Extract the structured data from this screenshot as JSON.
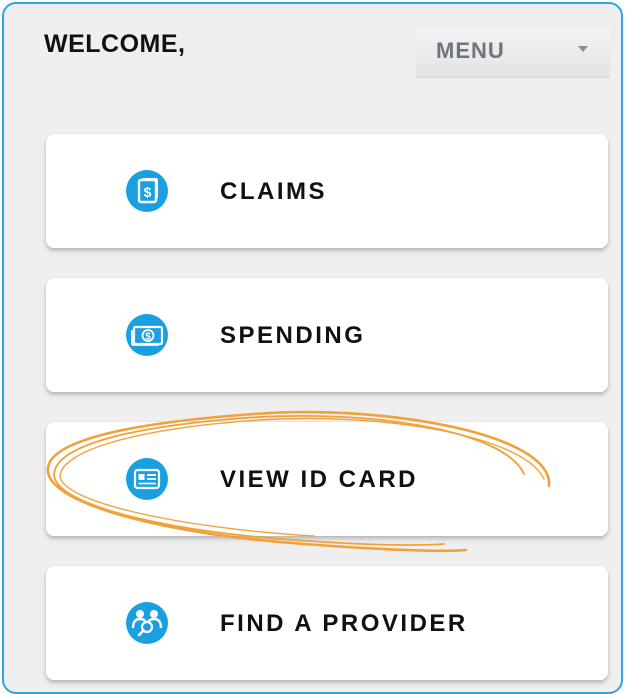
{
  "header": {
    "welcome_text": "WELCOME,",
    "menu_label": "MENU",
    "menu_caret_icon": "caret-down-icon"
  },
  "actions": [
    {
      "label": "CLAIMS",
      "icon": "claims-dollar-document-icon"
    },
    {
      "label": "SPENDING",
      "icon": "banknote-icon"
    },
    {
      "label": "VIEW ID CARD",
      "icon": "id-card-icon"
    },
    {
      "label": "FIND A PROVIDER",
      "icon": "provider-search-icon"
    }
  ],
  "highlight": {
    "target": "VIEW ID CARD",
    "style": "hand-drawn orange ellipse",
    "color": "#f0a13a"
  },
  "colors": {
    "accent": "#1a9fe0",
    "frame": "#2aa7e0",
    "background": "#efefef"
  }
}
